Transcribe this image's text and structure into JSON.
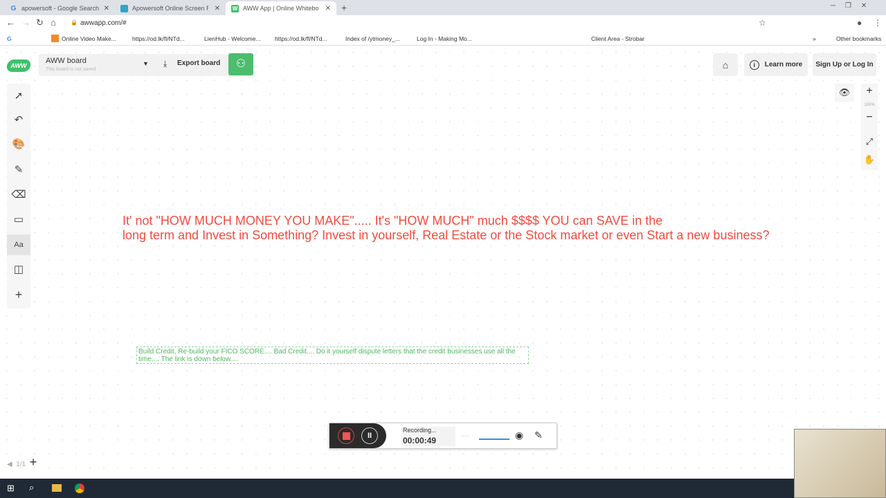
{
  "browser": {
    "tabs": [
      {
        "title": "apowersoft - Google Search",
        "icon": "google-icon"
      },
      {
        "title": "Apowersoft Online Screen Recor",
        "icon": "apowersoft-icon"
      },
      {
        "title": "AWW App | Online Whiteboard",
        "icon": "aww-icon",
        "active": true
      }
    ],
    "new_tab": "+",
    "close": "✕",
    "url": "awwapp.com/#",
    "bookmarks": [
      "Online Video Make...",
      "https://od.lk/fl/NTd...",
      "LienHub - Welcome...",
      "https://od.lk/fl/NTd...",
      "Index of /ytmoney_...",
      "Log In - Making Mo...",
      "Client Area - Strobar"
    ],
    "more": "»",
    "other_bookmarks": "Other bookmarks"
  },
  "app": {
    "logo": "AWW",
    "board_name": "AWW board",
    "board_status": "This board is not saved",
    "export_label": "Export board",
    "learn_more": "Learn more",
    "signup": "Sign Up or Log In",
    "zoom_level": "100%",
    "text_tool": "Aa",
    "page": "1/1",
    "canvas_text": {
      "line1": "It' not \"HOW MUCH MONEY YOU MAKE\"..... It's \"HOW MUCH\" much $$$$ YOU can SAVE in the",
      "line2": "long term and Invest in Something? Invest in yourself, Real Estate or the Stock market or even Start a new business?",
      "color": "#f04c3e"
    },
    "note_text": "Build Credit, Re-build your FICO SCORE.... Bad Credit.... Do it yourself dispute letters that the credit businesses use all the time.... The link is down below....",
    "accent": "#4cbd6f"
  },
  "recorder": {
    "status": "Recording...",
    "time": "00:00:49",
    "dots": "......"
  }
}
